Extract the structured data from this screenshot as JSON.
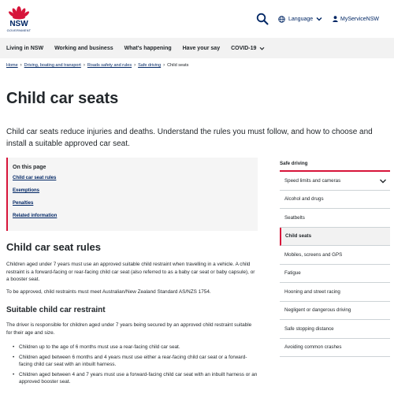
{
  "header": {
    "logo_text": "NSW",
    "logo_subtext": "GOVERNMENT",
    "language_label": "Language",
    "account_label": "MyServiceNSW",
    "brand_blue": "#002664",
    "brand_red": "#d7153a"
  },
  "nav": {
    "items": [
      {
        "label": "Living in NSW"
      },
      {
        "label": "Working and business"
      },
      {
        "label": "What's happening"
      },
      {
        "label": "Have your say"
      },
      {
        "label": "COVID-19"
      }
    ]
  },
  "breadcrumb": {
    "items": [
      "Home",
      "Driving, boating and transport",
      "Roads safety and rules",
      "Safe driving"
    ],
    "current": "Child seats"
  },
  "page": {
    "title": "Child car seats",
    "intro": "Child car seats reduce injuries and deaths. Understand the rules you must follow, and how to choose and install a suitable approved car seat."
  },
  "on_this_page": {
    "title": "On this page",
    "links": [
      "Child car seat rules",
      "Exemptions",
      "Penalties",
      "Related information"
    ]
  },
  "content": {
    "rules_heading": "Child car seat rules",
    "rules_p1": "Children aged under 7 years must use an approved suitable child restraint when travelling in a vehicle. A child restraint is a forward-facing or rear-facing child car seat (also referred to as a baby car seat or baby capsule), or a booster seat.",
    "rules_p2": "To be approved, child restraints must meet Australian/New Zealand Standard AS/NZS 1754.",
    "suitable_heading": "Suitable child car restraint",
    "suitable_p1": "The driver is responsible for children aged under 7 years being secured by an approved child restraint suitable for their age and size.",
    "bullets": [
      "Children up to the age of 6 months must use a rear-facing child car seat.",
      "Children aged between 6 months and 4 years must use either a rear-facing child car seat or a forward-facing child car seat with an inbuilt harness.",
      "Children aged between 4 and 7 years must use a forward-facing child car seat with an inbuilt harness or an approved booster seat."
    ]
  },
  "sidebar": {
    "title": "Safe driving",
    "items": [
      {
        "label": "Speed limits and cameras",
        "active": false
      },
      {
        "label": "Alcohol and drugs",
        "active": false
      },
      {
        "label": "Seatbelts",
        "active": false
      },
      {
        "label": "Child seats",
        "active": true
      },
      {
        "label": "Mobiles, screens and GPS",
        "active": false
      },
      {
        "label": "Fatigue",
        "active": false
      },
      {
        "label": "Hooning and street racing",
        "active": false
      },
      {
        "label": "Negligent or dangerous driving",
        "active": false
      },
      {
        "label": "Safe stopping distance",
        "active": false
      },
      {
        "label": "Avoiding common crashes",
        "active": false
      }
    ]
  }
}
